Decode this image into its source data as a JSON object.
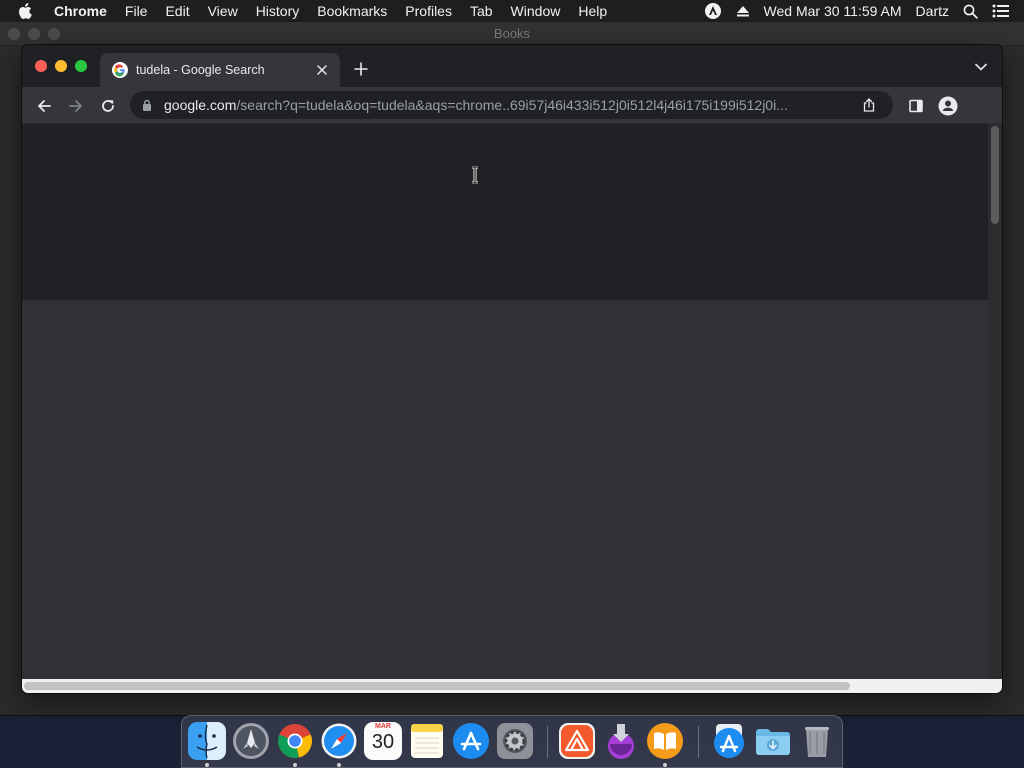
{
  "menubar": {
    "app_name": "Chrome",
    "items": [
      "File",
      "Edit",
      "View",
      "History",
      "Bookmarks",
      "Profiles",
      "Tab",
      "Window",
      "Help"
    ],
    "clock": "Wed Mar 30  11:59 AM",
    "user": "Dartz"
  },
  "background_window": {
    "title": "Books"
  },
  "browser": {
    "tab": {
      "title": "tudela - Google Search",
      "favicon": "google-g-icon"
    },
    "address_bar": {
      "domain": "google.com",
      "path": "/search?q=tudela&oq=tudela&aqs=chrome..69i57j46i433i512j0i512l4j46i175i199i512j0i..."
    }
  },
  "dock": {
    "apps": [
      {
        "name": "Finder",
        "icon": "finder-icon",
        "running": true
      },
      {
        "name": "Launchpad",
        "icon": "launchpad-icon",
        "running": false
      },
      {
        "name": "Google Chrome",
        "icon": "chrome-icon",
        "running": true
      },
      {
        "name": "Safari",
        "icon": "safari-icon",
        "running": true
      },
      {
        "name": "Calendar",
        "icon": "calendar-icon",
        "running": false
      },
      {
        "name": "Notes",
        "icon": "notes-icon",
        "running": false
      },
      {
        "name": "App Store",
        "icon": "app-store-icon",
        "running": false
      },
      {
        "name": "System Preferences",
        "icon": "system-preferences-icon",
        "running": false
      },
      {
        "name": "Creative Cloud",
        "icon": "creative-cloud-icon",
        "running": false
      },
      {
        "name": "Installer",
        "icon": "installer-icon",
        "running": false
      },
      {
        "name": "Books",
        "icon": "books-icon",
        "running": true
      },
      {
        "name": "Applications",
        "icon": "applications-folder-icon",
        "running": false
      },
      {
        "name": "Downloads",
        "icon": "downloads-folder-icon",
        "running": false
      },
      {
        "name": "Trash",
        "icon": "trash-icon",
        "running": false
      }
    ],
    "calendar_month": "MAR",
    "calendar_day": "30"
  },
  "colors": {
    "page_header": "#202124",
    "page_body": "#303134",
    "toolbar": "#35363a",
    "tabstrip": "#202124"
  }
}
